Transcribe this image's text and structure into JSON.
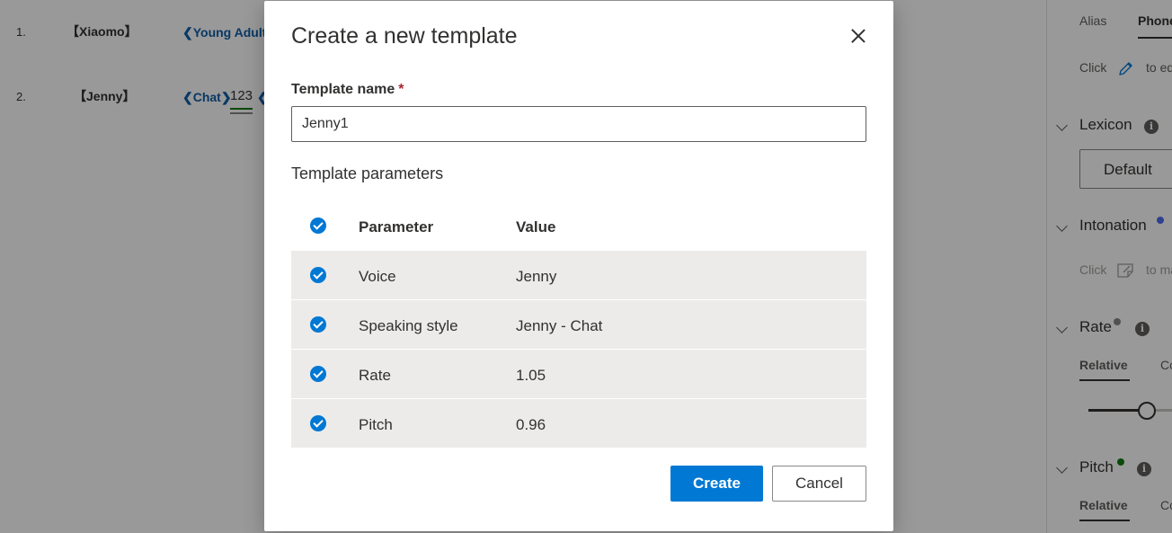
{
  "editor": {
    "lines": [
      {
        "number": "1.",
        "speaker": "【Xiaomo】",
        "tags": [
          "❮Young Adult"
        ]
      },
      {
        "number": "2.",
        "speaker": "【Jenny】",
        "tags": [
          "❮Chat❯"
        ],
        "word": "123",
        "trailing_tag": "❮"
      }
    ]
  },
  "panel": {
    "tabs": [
      {
        "label": "Alias",
        "active": false
      },
      {
        "label": "Phone",
        "active": true
      }
    ],
    "phoneme_hint": {
      "prefix": "Click",
      "suffix": "to edit",
      "icon": "pencil-icon"
    },
    "lexicon": {
      "title": "Lexicon",
      "button_label": "Default"
    },
    "intonation": {
      "title": "Intonation",
      "dot_color": "#4f6bed",
      "hint_prefix": "Click",
      "hint_suffix": "to mark",
      "icon": "note-icon"
    },
    "rate": {
      "title": "Rate",
      "dot_color": "#8a8886",
      "subtabs": [
        "Relative",
        "Constant"
      ],
      "slider_value": 0.55
    },
    "pitch": {
      "title": "Pitch",
      "dot_color": "#107c10",
      "subtabs": [
        "Relative",
        "Constant"
      ]
    }
  },
  "dialog": {
    "title": "Create a new template",
    "close_icon": "close-icon",
    "template_name": {
      "label": "Template name",
      "required_mark": "*",
      "value": "Jenny1"
    },
    "parameters_title": "Template parameters",
    "table": {
      "headers": {
        "parameter": "Parameter",
        "value": "Value"
      },
      "rows": [
        {
          "parameter": "Voice",
          "value": "Jenny",
          "checked": true
        },
        {
          "parameter": "Speaking style",
          "value": "Jenny - Chat",
          "checked": true
        },
        {
          "parameter": "Rate",
          "value": "1.05",
          "checked": true
        },
        {
          "parameter": "Pitch",
          "value": "0.96",
          "checked": true
        }
      ]
    },
    "buttons": {
      "create": "Create",
      "cancel": "Cancel"
    }
  },
  "colors": {
    "primary": "#0078d4",
    "tag": "#0f5ea8",
    "required": "#a4262c",
    "row_bg": "#edebe9"
  }
}
